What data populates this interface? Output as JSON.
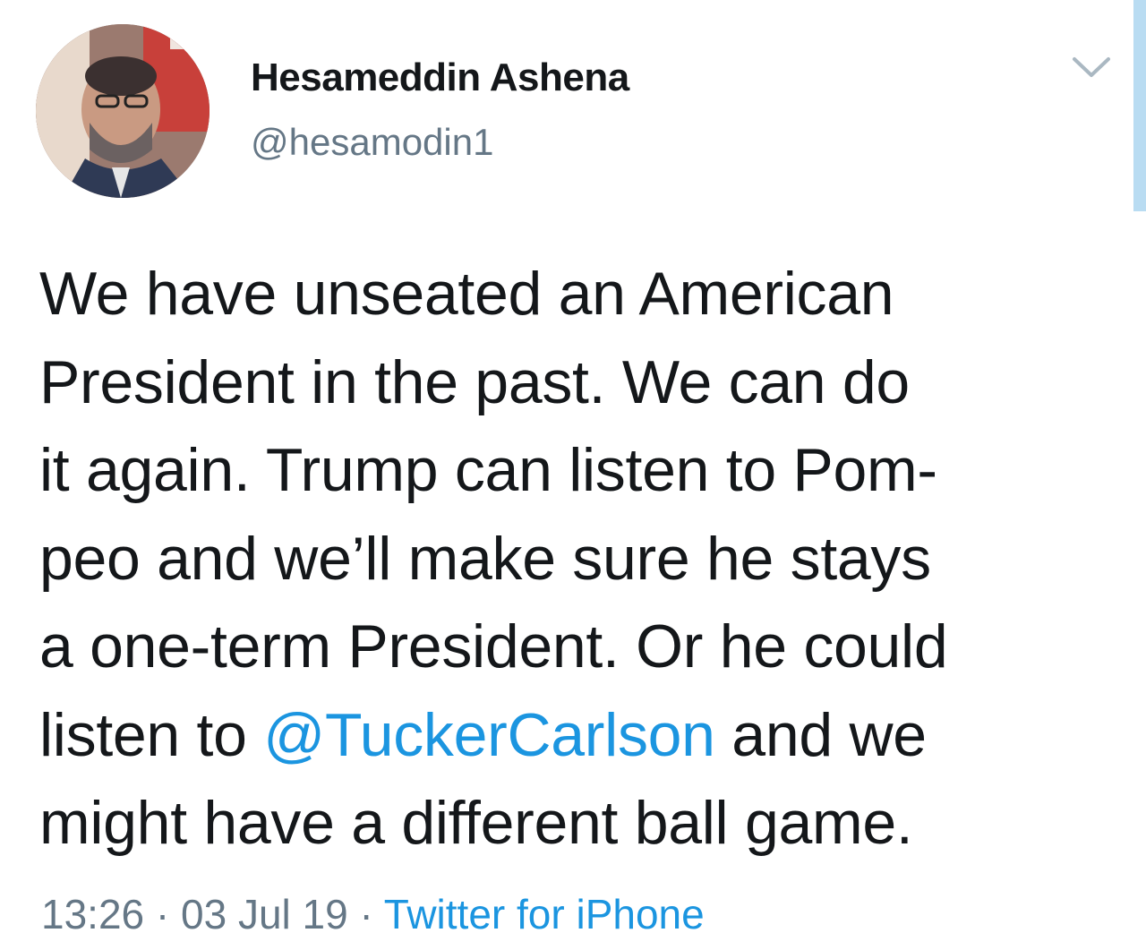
{
  "author": {
    "display_name": "Hesameddin Ashena",
    "handle": "@hesamodin1",
    "avatar_icon": "profile-photo"
  },
  "menu_icon": "chevron-down-icon",
  "tweet": {
    "line1": "We have unseated an American",
    "line2": "President in the past. We can do",
    "line3": "it again. Trump can listen to Pom-",
    "line4": "peo and we’ll make sure he stays",
    "line5": "a one-term President. Or he could",
    "line6_before": "listen to ",
    "mention": "@TuckerCarlson",
    "line6_after": " and we",
    "line7": "might have a different ball game."
  },
  "meta": {
    "time": "13:26",
    "separator": " · ",
    "date": "03 Jul 19",
    "source": "Twitter for iPhone"
  },
  "colors": {
    "text": "#14171a",
    "secondary": "#657786",
    "link": "#1b95e0",
    "edge_bar": "#b9dcf2"
  }
}
